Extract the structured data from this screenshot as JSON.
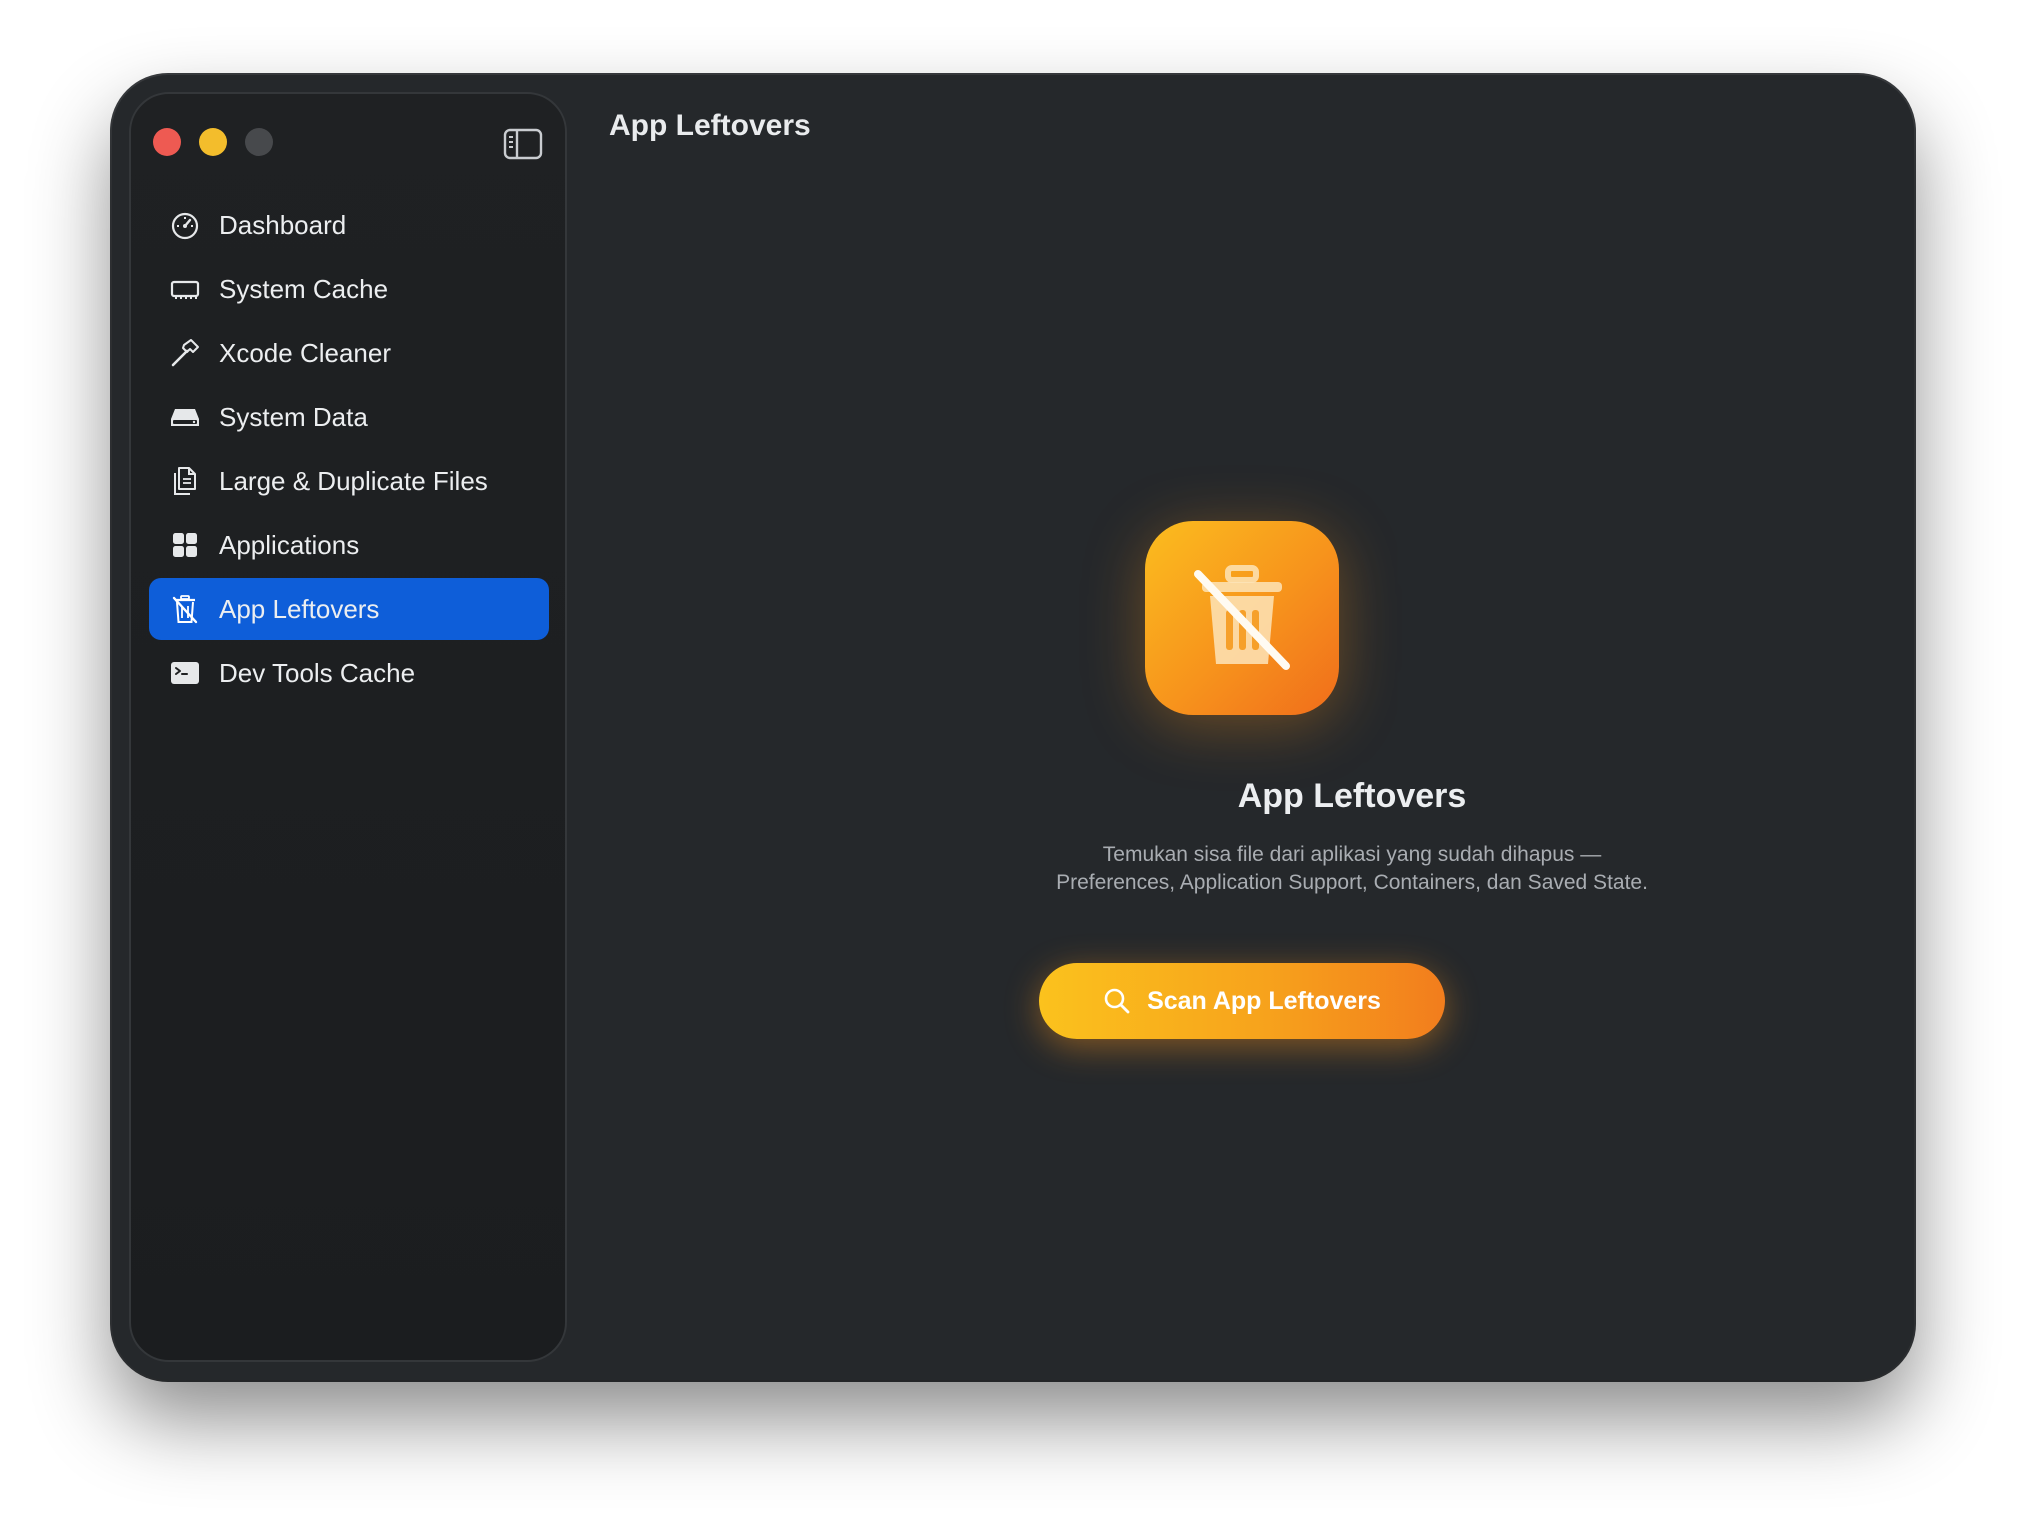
{
  "window": {
    "title": "App Leftovers"
  },
  "sidebar": {
    "items": [
      {
        "label": "Dashboard",
        "icon": "gauge-icon",
        "active": false
      },
      {
        "label": "System Cache",
        "icon": "memory-chip-icon",
        "active": false
      },
      {
        "label": "Xcode Cleaner",
        "icon": "hammer-icon",
        "active": false
      },
      {
        "label": "System Data",
        "icon": "drive-icon",
        "active": false
      },
      {
        "label": "Large & Duplicate Files",
        "icon": "duplicate-doc-icon",
        "active": false
      },
      {
        "label": "Applications",
        "icon": "grid-icon",
        "active": false
      },
      {
        "label": "App Leftovers",
        "icon": "trash-slash-icon",
        "active": true
      },
      {
        "label": "Dev Tools Cache",
        "icon": "terminal-icon",
        "active": false
      }
    ]
  },
  "hero": {
    "title": "App Leftovers",
    "description_line1": "Temukan sisa file dari aplikasi yang sudah dihapus —",
    "description_line2": "Preferences, Application Support, Containers, dan Saved State.",
    "icon": "trash-slash-icon"
  },
  "scan_button": {
    "label": "Scan App Leftovers",
    "icon": "search-icon"
  },
  "colors": {
    "accent_blue": "#0e5ed9",
    "accent_orange": "#f7931c",
    "window_bg": "#25282b",
    "sidebar_bg": "#1f2123"
  }
}
